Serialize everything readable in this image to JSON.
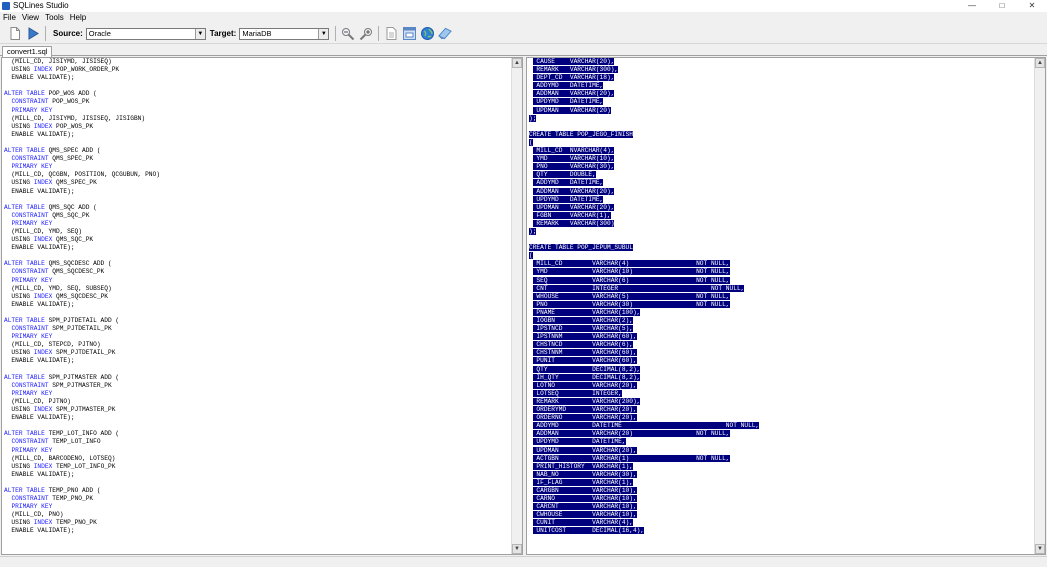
{
  "window": {
    "title": "SQLines Studio",
    "minimize": "—",
    "maximize": "□",
    "close": "✕"
  },
  "menu": {
    "file": "File",
    "view": "View",
    "tools": "Tools",
    "help": "Help"
  },
  "toolbar": {
    "source_label": "Source:",
    "source_value": "Oracle",
    "target_label": "Target:",
    "target_value": "MariaDB",
    "icons": [
      "new-file-icon",
      "run-convert-icon",
      "zoom-out-icon",
      "zoom-in-icon",
      "document-icon",
      "window-icon",
      "globe-icon",
      "feedback-icon"
    ]
  },
  "tabs": [
    "convert1.sql"
  ],
  "colors": {
    "keyword": "#1a1aff",
    "selection_bg": "#00007f",
    "selection_fg": "#ffffff"
  },
  "left_code": [
    [
      [
        "",
        "  (MILL_CD, JISIYMD, JISISEQ)"
      ]
    ],
    [
      [
        "",
        "  USING "
      ],
      [
        "k",
        "INDEX"
      ],
      [
        "",
        " POP_WORK_ORDER_PK"
      ]
    ],
    [
      [
        "",
        "  ENABLE VALIDATE);"
      ]
    ],
    [
      [
        "",
        ""
      ]
    ],
    [
      [
        "k",
        "ALTER TABLE"
      ],
      [
        "",
        " POP_WOS ADD ("
      ]
    ],
    [
      [
        "",
        "  "
      ],
      [
        "k",
        "CONSTRAINT"
      ],
      [
        "",
        " POP_WOS_PK"
      ]
    ],
    [
      [
        "",
        "  "
      ],
      [
        "k",
        "PRIMARY KEY"
      ]
    ],
    [
      [
        "",
        "  (MILL_CD, JISIYMD, JISISEQ, JISIGBN)"
      ]
    ],
    [
      [
        "",
        "  USING "
      ],
      [
        "k",
        "INDEX"
      ],
      [
        "",
        " POP_WOS_PK"
      ]
    ],
    [
      [
        "",
        "  ENABLE VALIDATE);"
      ]
    ],
    [
      [
        "",
        ""
      ]
    ],
    [
      [
        "k",
        "ALTER TABLE"
      ],
      [
        "",
        " QMS_SPEC ADD ("
      ]
    ],
    [
      [
        "",
        "  "
      ],
      [
        "k",
        "CONSTRAINT"
      ],
      [
        "",
        " QMS_SPEC_PK"
      ]
    ],
    [
      [
        "",
        "  "
      ],
      [
        "k",
        "PRIMARY KEY"
      ]
    ],
    [
      [
        "",
        "  (MILL_CD, QCGBN, POSITION, QCGUBUN, PNO)"
      ]
    ],
    [
      [
        "",
        "  USING "
      ],
      [
        "k",
        "INDEX"
      ],
      [
        "",
        " QMS_SPEC_PK"
      ]
    ],
    [
      [
        "",
        "  ENABLE VALIDATE);"
      ]
    ],
    [
      [
        "",
        ""
      ]
    ],
    [
      [
        "k",
        "ALTER TABLE"
      ],
      [
        "",
        " QMS_SQC ADD ("
      ]
    ],
    [
      [
        "",
        "  "
      ],
      [
        "k",
        "CONSTRAINT"
      ],
      [
        "",
        " QMS_SQC_PK"
      ]
    ],
    [
      [
        "",
        "  "
      ],
      [
        "k",
        "PRIMARY KEY"
      ]
    ],
    [
      [
        "",
        "  (MILL_CD, YMD, SEQ)"
      ]
    ],
    [
      [
        "",
        "  USING "
      ],
      [
        "k",
        "INDEX"
      ],
      [
        "",
        " QMS_SQC_PK"
      ]
    ],
    [
      [
        "",
        "  ENABLE VALIDATE);"
      ]
    ],
    [
      [
        "",
        ""
      ]
    ],
    [
      [
        "k",
        "ALTER TABLE"
      ],
      [
        "",
        " QMS_SQCDESC ADD ("
      ]
    ],
    [
      [
        "",
        "  "
      ],
      [
        "k",
        "CONSTRAINT"
      ],
      [
        "",
        " QMS_SQCDESC_PK"
      ]
    ],
    [
      [
        "",
        "  "
      ],
      [
        "k",
        "PRIMARY KEY"
      ]
    ],
    [
      [
        "",
        "  (MILL_CD, YMD, SEQ, SUBSEQ)"
      ]
    ],
    [
      [
        "",
        "  USING "
      ],
      [
        "k",
        "INDEX"
      ],
      [
        "",
        " QMS_SQCDESC_PK"
      ]
    ],
    [
      [
        "",
        "  ENABLE VALIDATE);"
      ]
    ],
    [
      [
        "",
        ""
      ]
    ],
    [
      [
        "k",
        "ALTER TABLE"
      ],
      [
        "",
        " SPM_PJTDETAIL ADD ("
      ]
    ],
    [
      [
        "",
        "  "
      ],
      [
        "k",
        "CONSTRAINT"
      ],
      [
        "",
        " SPM_PJTDETAIL_PK"
      ]
    ],
    [
      [
        "",
        "  "
      ],
      [
        "k",
        "PRIMARY KEY"
      ]
    ],
    [
      [
        "",
        "  (MILL_CD, STEPCD, PJTNO)"
      ]
    ],
    [
      [
        "",
        "  USING "
      ],
      [
        "k",
        "INDEX"
      ],
      [
        "",
        " SPM_PJTDETAIL_PK"
      ]
    ],
    [
      [
        "",
        "  ENABLE VALIDATE);"
      ]
    ],
    [
      [
        "",
        ""
      ]
    ],
    [
      [
        "k",
        "ALTER TABLE"
      ],
      [
        "",
        " SPM_PJTMASTER ADD ("
      ]
    ],
    [
      [
        "",
        "  "
      ],
      [
        "k",
        "CONSTRAINT"
      ],
      [
        "",
        " SPM_PJTMASTER_PK"
      ]
    ],
    [
      [
        "",
        "  "
      ],
      [
        "k",
        "PRIMARY KEY"
      ]
    ],
    [
      [
        "",
        "  (MILL_CD, PJTNO)"
      ]
    ],
    [
      [
        "",
        "  USING "
      ],
      [
        "k",
        "INDEX"
      ],
      [
        "",
        " SPM_PJTMASTER_PK"
      ]
    ],
    [
      [
        "",
        "  ENABLE VALIDATE);"
      ]
    ],
    [
      [
        "",
        ""
      ]
    ],
    [
      [
        "k",
        "ALTER TABLE"
      ],
      [
        "",
        " TEMP_LOT_INFO ADD ("
      ]
    ],
    [
      [
        "",
        "  "
      ],
      [
        "k",
        "CONSTRAINT"
      ],
      [
        "",
        " TEMP_LOT_INFO"
      ]
    ],
    [
      [
        "",
        "  "
      ],
      [
        "k",
        "PRIMARY KEY"
      ]
    ],
    [
      [
        "",
        "  (MILL_CD, BARCODENO, LOTSEQ)"
      ]
    ],
    [
      [
        "",
        "  USING "
      ],
      [
        "k",
        "INDEX"
      ],
      [
        "",
        " TEMP_LOT_INFO_PK"
      ]
    ],
    [
      [
        "",
        "  ENABLE VALIDATE);"
      ]
    ],
    [
      [
        "",
        ""
      ]
    ],
    [
      [
        "k",
        "ALTER TABLE"
      ],
      [
        "",
        " TEMP_PNO ADD ("
      ]
    ],
    [
      [
        "",
        "  "
      ],
      [
        "k",
        "CONSTRAINT"
      ],
      [
        "",
        " TEMP_PNO_PK"
      ]
    ],
    [
      [
        "",
        "  "
      ],
      [
        "k",
        "PRIMARY KEY"
      ]
    ],
    [
      [
        "",
        "  (MILL_CD, PNO)"
      ]
    ],
    [
      [
        "",
        "  USING "
      ],
      [
        "k",
        "INDEX"
      ],
      [
        "",
        " TEMP_PNO_PK"
      ]
    ],
    [
      [
        "",
        "  ENABLE VALIDATE);"
      ]
    ]
  ],
  "right_code": [
    [
      [
        "",
        " "
      ],
      [
        "s",
        " CAUSE    VARCHAR(20),"
      ]
    ],
    [
      [
        "",
        " "
      ],
      [
        "s",
        " REMARK   VARCHAR(300),"
      ]
    ],
    [
      [
        "",
        " "
      ],
      [
        "s",
        " DEPT_CD  VARCHAR(18),"
      ]
    ],
    [
      [
        "",
        " "
      ],
      [
        "s",
        " ADDYMD   DATETIME,"
      ]
    ],
    [
      [
        "",
        " "
      ],
      [
        "s",
        " ADDMAN   VARCHAR(20),"
      ]
    ],
    [
      [
        "",
        " "
      ],
      [
        "s",
        " UPDYMD   DATETIME,"
      ]
    ],
    [
      [
        "",
        " "
      ],
      [
        "s",
        " UPDMAN   VARCHAR(20)"
      ]
    ],
    [
      [
        "s",
        ");"
      ]
    ],
    [
      [
        "",
        ""
      ]
    ],
    [
      [
        "s",
        "CREATE TABLE POP_JEGO_FINISH"
      ]
    ],
    [
      [
        "s",
        "("
      ]
    ],
    [
      [
        "",
        " "
      ],
      [
        "s",
        " MILL_CD  NVARCHAR(4),"
      ]
    ],
    [
      [
        "",
        " "
      ],
      [
        "s",
        " YMD      VARCHAR(10),"
      ]
    ],
    [
      [
        "",
        " "
      ],
      [
        "s",
        " PNO      VARCHAR(30),"
      ]
    ],
    [
      [
        "",
        " "
      ],
      [
        "s",
        " QTY      DOUBLE,"
      ]
    ],
    [
      [
        "",
        " "
      ],
      [
        "s",
        " ADDYMD   DATETIME,"
      ]
    ],
    [
      [
        "",
        " "
      ],
      [
        "s",
        " ADDMAN   VARCHAR(20),"
      ]
    ],
    [
      [
        "",
        " "
      ],
      [
        "s",
        " UPDYMD   DATETIME,"
      ]
    ],
    [
      [
        "",
        " "
      ],
      [
        "s",
        " UPDMAN   VARCHAR(20),"
      ]
    ],
    [
      [
        "",
        " "
      ],
      [
        "s",
        " FGBN     VARCHAR(1),"
      ]
    ],
    [
      [
        "",
        " "
      ],
      [
        "s",
        " REMARK   VARCHAR(300)"
      ]
    ],
    [
      [
        "s",
        ");"
      ]
    ],
    [
      [
        "",
        ""
      ]
    ],
    [
      [
        "s",
        "CREATE TABLE POP_JEPUM_SUBUL"
      ]
    ],
    [
      [
        "s",
        "("
      ]
    ],
    [
      [
        "",
        " "
      ],
      [
        "s",
        " MILL_CD        VARCHAR(4)                  NOT NULL,"
      ]
    ],
    [
      [
        "",
        " "
      ],
      [
        "s",
        " YMD            VARCHAR(10)                 NOT NULL,"
      ]
    ],
    [
      [
        "",
        " "
      ],
      [
        "s",
        " SEQ            VARCHAR(6)                  NOT NULL,"
      ]
    ],
    [
      [
        "",
        " "
      ],
      [
        "s",
        " CNT            INTEGER                         NOT NULL,"
      ]
    ],
    [
      [
        "",
        " "
      ],
      [
        "s",
        " WHOUSE         VARCHAR(5)                  NOT NULL,"
      ]
    ],
    [
      [
        "",
        " "
      ],
      [
        "s",
        " PNO            VARCHAR(30)                 NOT NULL,"
      ]
    ],
    [
      [
        "",
        " "
      ],
      [
        "s",
        " PNAME          VARCHAR(100),"
      ]
    ],
    [
      [
        "",
        " "
      ],
      [
        "s",
        " IOGBN          VARCHAR(2),"
      ]
    ],
    [
      [
        "",
        " "
      ],
      [
        "s",
        " IPSTNCD        VARCHAR(5),"
      ]
    ],
    [
      [
        "",
        " "
      ],
      [
        "s",
        " IPSTNNM        VARCHAR(60),"
      ]
    ],
    [
      [
        "",
        " "
      ],
      [
        "s",
        " CHSTNCD        VARCHAR(6),"
      ]
    ],
    [
      [
        "",
        " "
      ],
      [
        "s",
        " CHSTNNM        VARCHAR(60),"
      ]
    ],
    [
      [
        "",
        " "
      ],
      [
        "s",
        " PUNIT          VARCHAR(60),"
      ]
    ],
    [
      [
        "",
        " "
      ],
      [
        "s",
        " QTY            DECIMAL(8,2),"
      ]
    ],
    [
      [
        "",
        " "
      ],
      [
        "s",
        " IH_QTY         DECIMAL(8,2),"
      ]
    ],
    [
      [
        "",
        " "
      ],
      [
        "s",
        " LOTNO          VARCHAR(20),"
      ]
    ],
    [
      [
        "",
        " "
      ],
      [
        "s",
        " LOTSEQ         INTEGER,"
      ]
    ],
    [
      [
        "",
        " "
      ],
      [
        "s",
        " REMARK         VARCHAR(200),"
      ]
    ],
    [
      [
        "",
        " "
      ],
      [
        "s",
        " ORDERYMD       VARCHAR(20),"
      ]
    ],
    [
      [
        "",
        " "
      ],
      [
        "s",
        " ORDERNO        VARCHAR(20),"
      ]
    ],
    [
      [
        "",
        " "
      ],
      [
        "s",
        " ADDYMD         DATETIME                            NOT NULL,"
      ]
    ],
    [
      [
        "",
        " "
      ],
      [
        "s",
        " ADDMAN         VARCHAR(20)                 NOT NULL,"
      ]
    ],
    [
      [
        "",
        " "
      ],
      [
        "s",
        " UPDYMD         DATETIME,"
      ]
    ],
    [
      [
        "",
        " "
      ],
      [
        "s",
        " UPDMAN         VARCHAR(20),"
      ]
    ],
    [
      [
        "",
        " "
      ],
      [
        "s",
        " ACTGBN         VARCHAR(1)                  NOT NULL,"
      ]
    ],
    [
      [
        "",
        " "
      ],
      [
        "s",
        " PRINT_HISTORY  VARCHAR(1),"
      ]
    ],
    [
      [
        "",
        " "
      ],
      [
        "s",
        " NAB_NO         VARCHAR(30),"
      ]
    ],
    [
      [
        "",
        " "
      ],
      [
        "s",
        " IF_FLAG        VARCHAR(1),"
      ]
    ],
    [
      [
        "",
        " "
      ],
      [
        "s",
        " CARGBN         VARCHAR(10),"
      ]
    ],
    [
      [
        "",
        " "
      ],
      [
        "s",
        " CARNO          VARCHAR(10),"
      ]
    ],
    [
      [
        "",
        " "
      ],
      [
        "s",
        " CARCNT         VARCHAR(10),"
      ]
    ],
    [
      [
        "",
        " "
      ],
      [
        "s",
        " CWHOUSE        VARCHAR(10),"
      ]
    ],
    [
      [
        "",
        " "
      ],
      [
        "s",
        " CUNIT          VARCHAR(4),"
      ]
    ],
    [
      [
        "",
        " "
      ],
      [
        "s",
        " UNITCOST       DECIMAL(16,4),"
      ]
    ]
  ]
}
